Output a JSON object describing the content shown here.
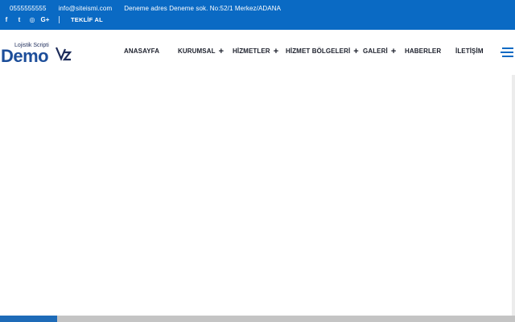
{
  "topbar": {
    "phone": "0555555555",
    "email": "info@siteismi.com",
    "address": "Deneme adres Deneme sok. No:52/1 Merkez/ADANA",
    "social": [
      {
        "icon": "facebook-icon",
        "glyph": "f"
      },
      {
        "icon": "twitter-icon",
        "glyph": "t"
      },
      {
        "icon": "instagram-icon",
        "glyph": "◎"
      },
      {
        "icon": "google-plus-icon",
        "glyph": "G+"
      }
    ],
    "cta": "TEKLİF AL",
    "bg_color": "#0a6ac4"
  },
  "logo": {
    "small": "Lojistik Scripti",
    "big": "Demo",
    "color": "#1d4e9a"
  },
  "nav": {
    "items": [
      {
        "label": "ANASAYFA",
        "has_submenu": false
      },
      {
        "label": "KURUMSAL",
        "has_submenu": true
      },
      {
        "label": "HİZMETLER",
        "has_submenu": true
      },
      {
        "label": "HİZMET BÖLGELERİ",
        "has_submenu": true
      },
      {
        "label": "GALERİ",
        "has_submenu": true
      },
      {
        "label": "HABERLER",
        "has_submenu": false
      },
      {
        "label": "İLETİŞİM",
        "has_submenu": false
      }
    ],
    "submenu_indicator": "+",
    "menu_icon": "hamburger-menu-icon"
  },
  "scrollbar": {
    "thumb_color": "#1e6bb8"
  }
}
